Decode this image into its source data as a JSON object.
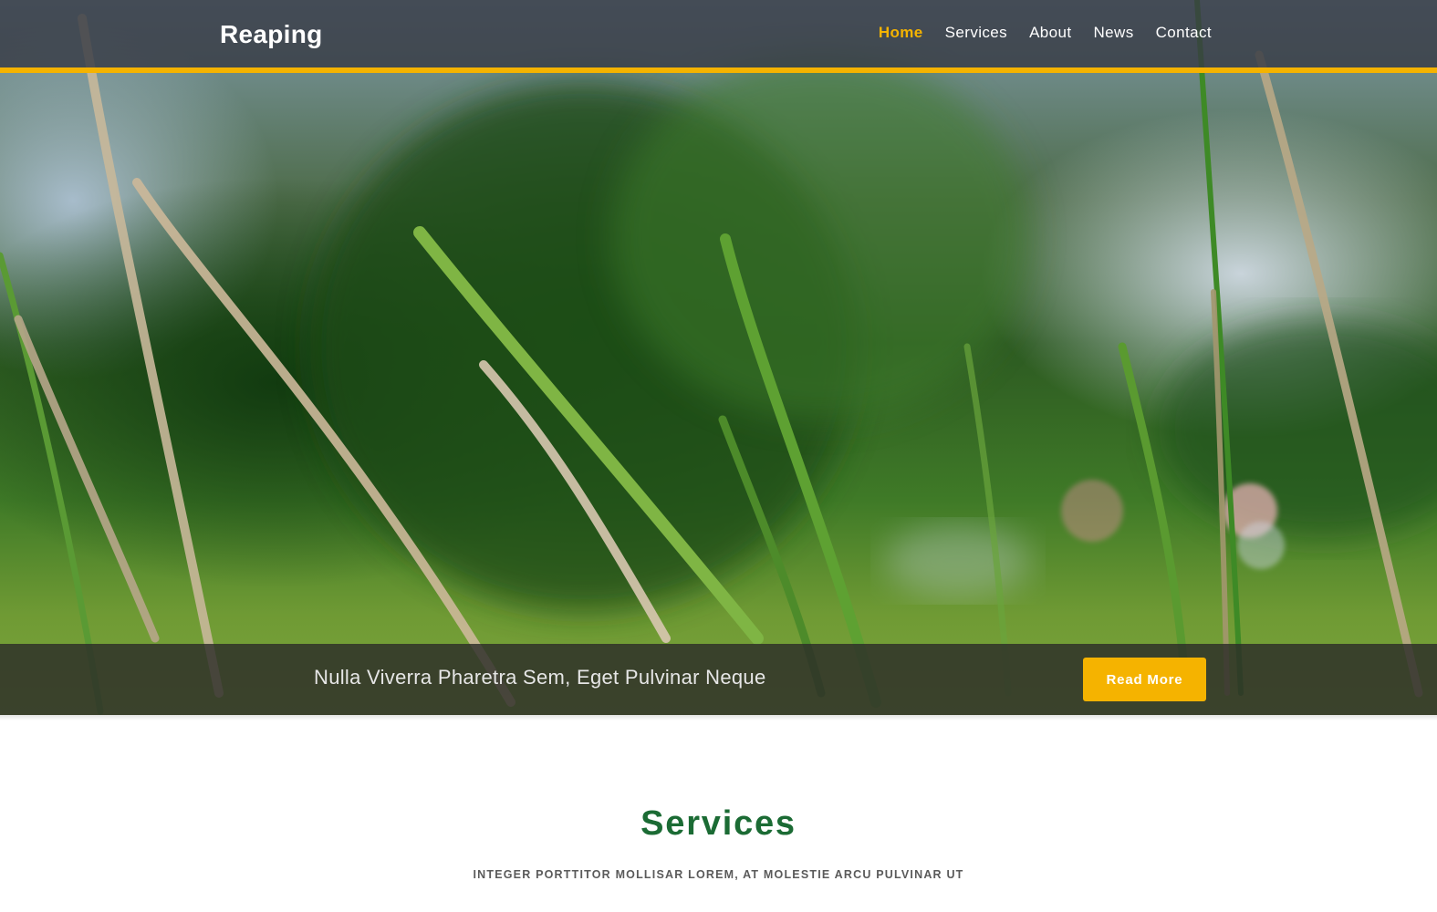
{
  "header": {
    "brand": "Reaping",
    "nav": [
      {
        "label": "Home",
        "active": true
      },
      {
        "label": "Services",
        "active": false
      },
      {
        "label": "About",
        "active": false
      },
      {
        "label": "News",
        "active": false
      },
      {
        "label": "Contact",
        "active": false
      }
    ]
  },
  "hero": {
    "caption": "Nulla Viverra Pharetra Sem, Eget Pulvinar Neque",
    "button_label": "Read More"
  },
  "services": {
    "title": "Services",
    "subtitle": "INTEGER PORTTITOR MOLLISAR LOREM, AT MOLESTIE ARCU PULVINAR UT"
  },
  "colors": {
    "accent": "#f5b300",
    "heading_green": "#1b6b34"
  }
}
